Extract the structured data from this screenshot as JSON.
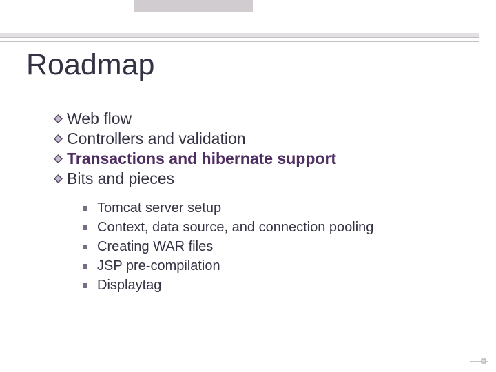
{
  "title": "Roadmap",
  "main": {
    "item1": "Web flow",
    "item2": "Controllers and validation",
    "item3": "Transactions and hibernate support",
    "item4": "Bits and pieces"
  },
  "sub": {
    "s1": "Tomcat server setup",
    "s2": "Context, data source, and connection pooling",
    "s3": "Creating WAR files",
    "s4": "JSP pre-compilation",
    "s5": "Displaytag"
  }
}
